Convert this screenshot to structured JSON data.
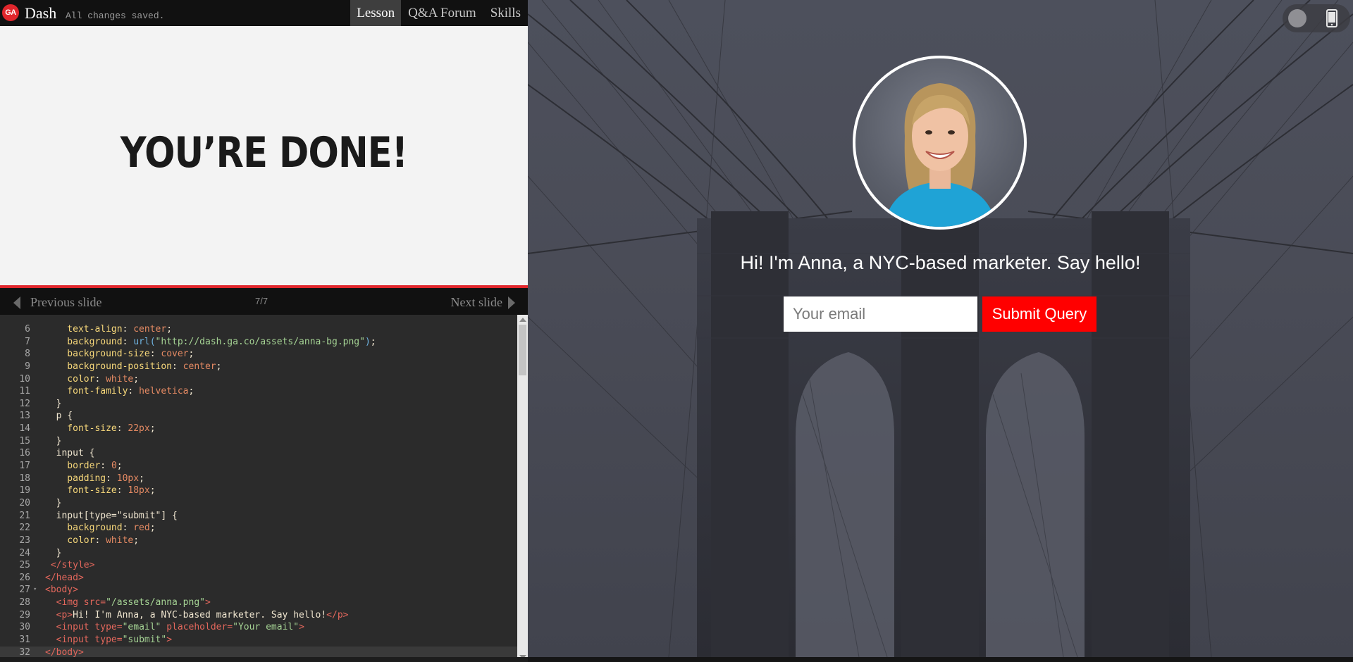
{
  "topbar": {
    "logo_text": "GA",
    "app_name": "Dash",
    "save_status": "All changes saved.",
    "tabs": [
      {
        "label": "Lesson",
        "active": true
      },
      {
        "label": "Q&A Forum",
        "active": false
      },
      {
        "label": "Skills",
        "active": false
      }
    ]
  },
  "slide": {
    "text": "YOU’RE DONE!",
    "counter": "7/7",
    "prev_label": "Previous slide",
    "next_label": "Next slide"
  },
  "editor": {
    "active_line": 32,
    "lines": [
      {
        "num": "6",
        "fold": false,
        "tokens": [
          [
            "t-prop",
            "    text-align"
          ],
          [
            "t-txt",
            ": "
          ],
          [
            "t-val",
            "center"
          ],
          [
            "t-txt",
            ";"
          ]
        ]
      },
      {
        "num": "7",
        "fold": false,
        "tokens": [
          [
            "t-prop",
            "    background"
          ],
          [
            "t-txt",
            ": "
          ],
          [
            "t-fn",
            "url("
          ],
          [
            "t-str",
            "\"http://dash.ga.co/assets/anna-bg.png\""
          ],
          [
            "t-fn",
            ")"
          ],
          [
            "t-txt",
            ";"
          ]
        ]
      },
      {
        "num": "8",
        "fold": false,
        "tokens": [
          [
            "t-prop",
            "    background-size"
          ],
          [
            "t-txt",
            ": "
          ],
          [
            "t-val",
            "cover"
          ],
          [
            "t-txt",
            ";"
          ]
        ]
      },
      {
        "num": "9",
        "fold": false,
        "tokens": [
          [
            "t-prop",
            "    background-position"
          ],
          [
            "t-txt",
            ": "
          ],
          [
            "t-val",
            "center"
          ],
          [
            "t-txt",
            ";"
          ]
        ]
      },
      {
        "num": "10",
        "fold": false,
        "tokens": [
          [
            "t-prop",
            "    color"
          ],
          [
            "t-txt",
            ": "
          ],
          [
            "t-val",
            "white"
          ],
          [
            "t-txt",
            ";"
          ]
        ]
      },
      {
        "num": "11",
        "fold": false,
        "tokens": [
          [
            "t-prop",
            "    font-family"
          ],
          [
            "t-txt",
            ": "
          ],
          [
            "t-val",
            "helvetica"
          ],
          [
            "t-txt",
            ";"
          ]
        ]
      },
      {
        "num": "12",
        "fold": false,
        "tokens": [
          [
            "t-txt",
            "  }"
          ]
        ]
      },
      {
        "num": "13",
        "fold": false,
        "tokens": [
          [
            "t-sel",
            "  p {"
          ]
        ]
      },
      {
        "num": "14",
        "fold": false,
        "tokens": [
          [
            "t-prop",
            "    font-size"
          ],
          [
            "t-txt",
            ": "
          ],
          [
            "t-num",
            "22px"
          ],
          [
            "t-txt",
            ";"
          ]
        ]
      },
      {
        "num": "15",
        "fold": false,
        "tokens": [
          [
            "t-txt",
            "  }"
          ]
        ]
      },
      {
        "num": "16",
        "fold": false,
        "tokens": [
          [
            "t-sel",
            "  input {"
          ]
        ]
      },
      {
        "num": "17",
        "fold": false,
        "tokens": [
          [
            "t-prop",
            "    border"
          ],
          [
            "t-txt",
            ": "
          ],
          [
            "t-num",
            "0"
          ],
          [
            "t-txt",
            ";"
          ]
        ]
      },
      {
        "num": "18",
        "fold": false,
        "tokens": [
          [
            "t-prop",
            "    padding"
          ],
          [
            "t-txt",
            ": "
          ],
          [
            "t-num",
            "10px"
          ],
          [
            "t-txt",
            ";"
          ]
        ]
      },
      {
        "num": "19",
        "fold": false,
        "tokens": [
          [
            "t-prop",
            "    font-size"
          ],
          [
            "t-txt",
            ": "
          ],
          [
            "t-num",
            "18px"
          ],
          [
            "t-txt",
            ";"
          ]
        ]
      },
      {
        "num": "20",
        "fold": false,
        "tokens": [
          [
            "t-txt",
            "  }"
          ]
        ]
      },
      {
        "num": "21",
        "fold": false,
        "tokens": [
          [
            "t-sel",
            "  input[type=\"submit\"] {"
          ]
        ]
      },
      {
        "num": "22",
        "fold": false,
        "tokens": [
          [
            "t-prop",
            "    background"
          ],
          [
            "t-txt",
            ": "
          ],
          [
            "t-val",
            "red"
          ],
          [
            "t-txt",
            ";"
          ]
        ]
      },
      {
        "num": "23",
        "fold": false,
        "tokens": [
          [
            "t-prop",
            "    color"
          ],
          [
            "t-txt",
            ": "
          ],
          [
            "t-val",
            "white"
          ],
          [
            "t-txt",
            ";"
          ]
        ]
      },
      {
        "num": "24",
        "fold": false,
        "tokens": [
          [
            "t-txt",
            "  }"
          ]
        ]
      },
      {
        "num": "25",
        "fold": false,
        "tokens": [
          [
            "t-tag",
            " </style>"
          ]
        ]
      },
      {
        "num": "26",
        "fold": false,
        "tokens": [
          [
            "t-tag",
            "</head>"
          ]
        ]
      },
      {
        "num": "27",
        "fold": true,
        "tokens": [
          [
            "t-tag",
            "<body>"
          ]
        ]
      },
      {
        "num": "28",
        "fold": false,
        "tokens": [
          [
            "t-tag",
            "  <img "
          ],
          [
            "t-attr",
            "src="
          ],
          [
            "t-str",
            "\"/assets/anna.png\""
          ],
          [
            "t-tag",
            ">"
          ]
        ]
      },
      {
        "num": "29",
        "fold": false,
        "tokens": [
          [
            "t-tag",
            "  <p>"
          ],
          [
            "t-txt",
            "Hi! I'm Anna, a NYC-based marketer. Say hello!"
          ],
          [
            "t-tag",
            "</p>"
          ]
        ]
      },
      {
        "num": "30",
        "fold": false,
        "tokens": [
          [
            "t-tag",
            "  <input "
          ],
          [
            "t-attr",
            "type="
          ],
          [
            "t-str",
            "\"email\""
          ],
          [
            "t-attr",
            " placeholder="
          ],
          [
            "t-str",
            "\"Your email\""
          ],
          [
            "t-tag",
            ">"
          ]
        ]
      },
      {
        "num": "31",
        "fold": false,
        "tokens": [
          [
            "t-tag",
            "  <input "
          ],
          [
            "t-attr",
            "type="
          ],
          [
            "t-str",
            "\"submit\""
          ],
          [
            "t-tag",
            ">"
          ]
        ]
      },
      {
        "num": "32",
        "fold": false,
        "tokens": [
          [
            "t-tag",
            "</body>"
          ]
        ]
      }
    ]
  },
  "preview": {
    "tagline": "Hi! I'm Anna, a NYC-based marketer. Say hello!",
    "email_placeholder": "Your email",
    "submit_label": "Submit Query",
    "submit_color": "#ff0000",
    "avatar_icon": "person-photo"
  },
  "colors": {
    "accent": "#e0262c",
    "editor_bg": "#2b2b2b",
    "slide_bg": "#f3f3f3"
  }
}
